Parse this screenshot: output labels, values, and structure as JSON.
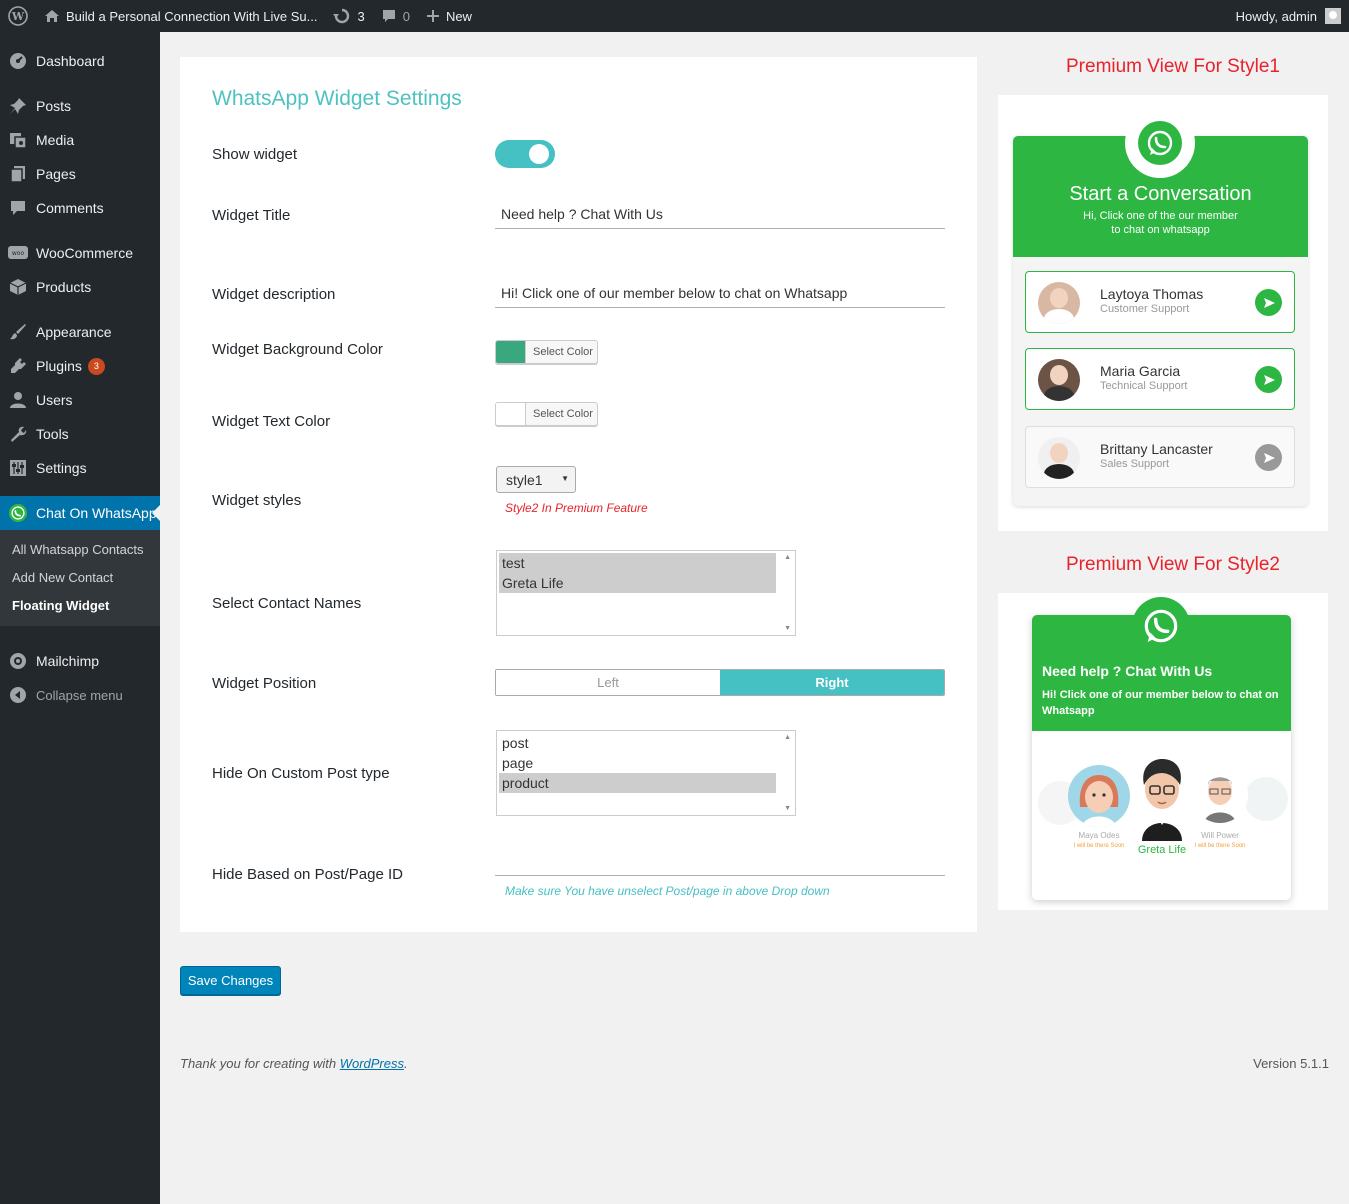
{
  "adminbar": {
    "site_title": "Build a Personal Connection With Live Su...",
    "updates_count": "3",
    "comments_count": "0",
    "new_label": "New",
    "greeting": "Howdy, admin"
  },
  "sidebar": {
    "items": [
      {
        "label": "Dashboard"
      },
      {
        "label": "Posts"
      },
      {
        "label": "Media"
      },
      {
        "label": "Pages"
      },
      {
        "label": "Comments"
      },
      {
        "label": "WooCommerce"
      },
      {
        "label": "Products"
      },
      {
        "label": "Appearance"
      },
      {
        "label": "Plugins",
        "badge": "3"
      },
      {
        "label": "Users"
      },
      {
        "label": "Tools"
      },
      {
        "label": "Settings"
      },
      {
        "label": "Chat On WhatsApp"
      },
      {
        "label": "Mailchimp"
      },
      {
        "label": "Collapse menu"
      }
    ],
    "submenu": [
      "All Whatsapp Contacts",
      "Add New Contact",
      "Floating Widget"
    ]
  },
  "settings": {
    "title": "WhatsApp Widget Settings",
    "show_widget_label": "Show widget",
    "widget_title_label": "Widget Title",
    "widget_title_value": "Need help ? Chat With Us",
    "widget_desc_label": "Widget description",
    "widget_desc_value": "Hi! Click one of our member below to chat on Whatsapp",
    "bg_color_label": "Widget Background Color",
    "bg_color_value": "#3ba77f",
    "text_color_label": "Widget Text Color",
    "text_color_value": "#ffffff",
    "select_color_label": "Select Color",
    "styles_label": "Widget styles",
    "styles_value": "style1",
    "styles_note": "Style2 In Premium Feature",
    "contacts_label": "Select Contact Names",
    "contacts_options": [
      "test",
      "Greta Life"
    ],
    "position_label": "Widget Position",
    "position_left": "Left",
    "position_right": "Right",
    "hide_post_type_label": "Hide On Custom Post type",
    "post_type_options": [
      "post",
      "page",
      "product"
    ],
    "hide_id_label": "Hide Based on Post/Page ID",
    "hide_id_note": "Make sure You have unselect Post/page in above Drop down",
    "save_label": "Save Changes"
  },
  "footer": {
    "text_before": "Thank you for creating with ",
    "link": "WordPress",
    "text_after": ".",
    "version": "Version 5.1.1"
  },
  "premium1": {
    "title": "Premium View For Style1",
    "heading": "Start a Conversation",
    "sub1": "Hi, Click one of the our member",
    "sub2": "to chat on whatsapp",
    "members": [
      {
        "name": "Laytoya Thomas",
        "role": "Customer Support"
      },
      {
        "name": "Maria Garcia",
        "role": "Technical Support"
      },
      {
        "name": "Brittany Lancaster",
        "role": "Sales Support"
      }
    ]
  },
  "premium2": {
    "title": "Premium View For Style2",
    "heading": "Need help ? Chat With Us",
    "sub": "Hi! Click one of our member below to chat on Whatsapp",
    "members": [
      {
        "name": "Maya Odes",
        "tag": "I will be there Soon"
      },
      {
        "name": "Greta Life"
      },
      {
        "name": "Will Power",
        "tag": "I will be there Soon"
      }
    ]
  },
  "colors": {
    "accent": "#45c0c3",
    "whatsapp_green": "#2db742",
    "wp_blue": "#0073aa",
    "premium_red": "#e8232b"
  }
}
